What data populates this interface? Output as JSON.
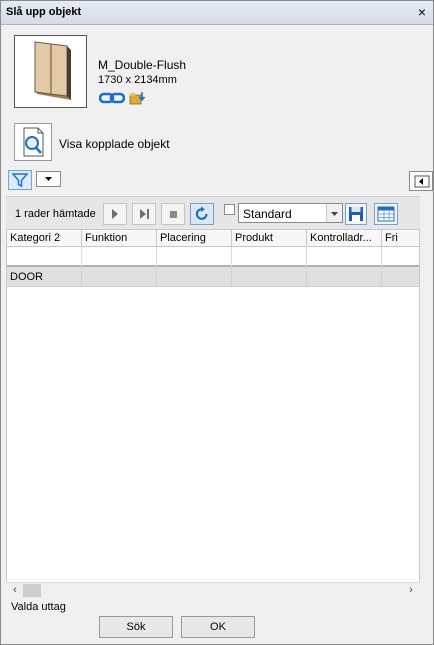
{
  "dialog": {
    "title": "Slå upp objekt",
    "close_symbol": "×"
  },
  "object": {
    "name": "M_Double-Flush",
    "dimensions": "1730 x 2134mm"
  },
  "view_linked": {
    "label": "Visa kopplade objekt"
  },
  "toolbar": {
    "rows_status": "1 rader hämtade",
    "standard_checked": false,
    "view_select_value": "Standard"
  },
  "grid": {
    "columns": [
      "Kategori 2",
      "Funktion",
      "Placering",
      "Produkt",
      "Kontrolladr...",
      "Fri"
    ],
    "rows": [
      [
        "DOOR",
        "",
        "",
        "",
        "",
        ""
      ]
    ]
  },
  "footer": {
    "valda_label": "Valda uttag",
    "search_button": "Sök",
    "ok_button": "OK"
  },
  "colors": {
    "accent": "#1e6fc8",
    "selection_row": "#e0e0e0"
  }
}
